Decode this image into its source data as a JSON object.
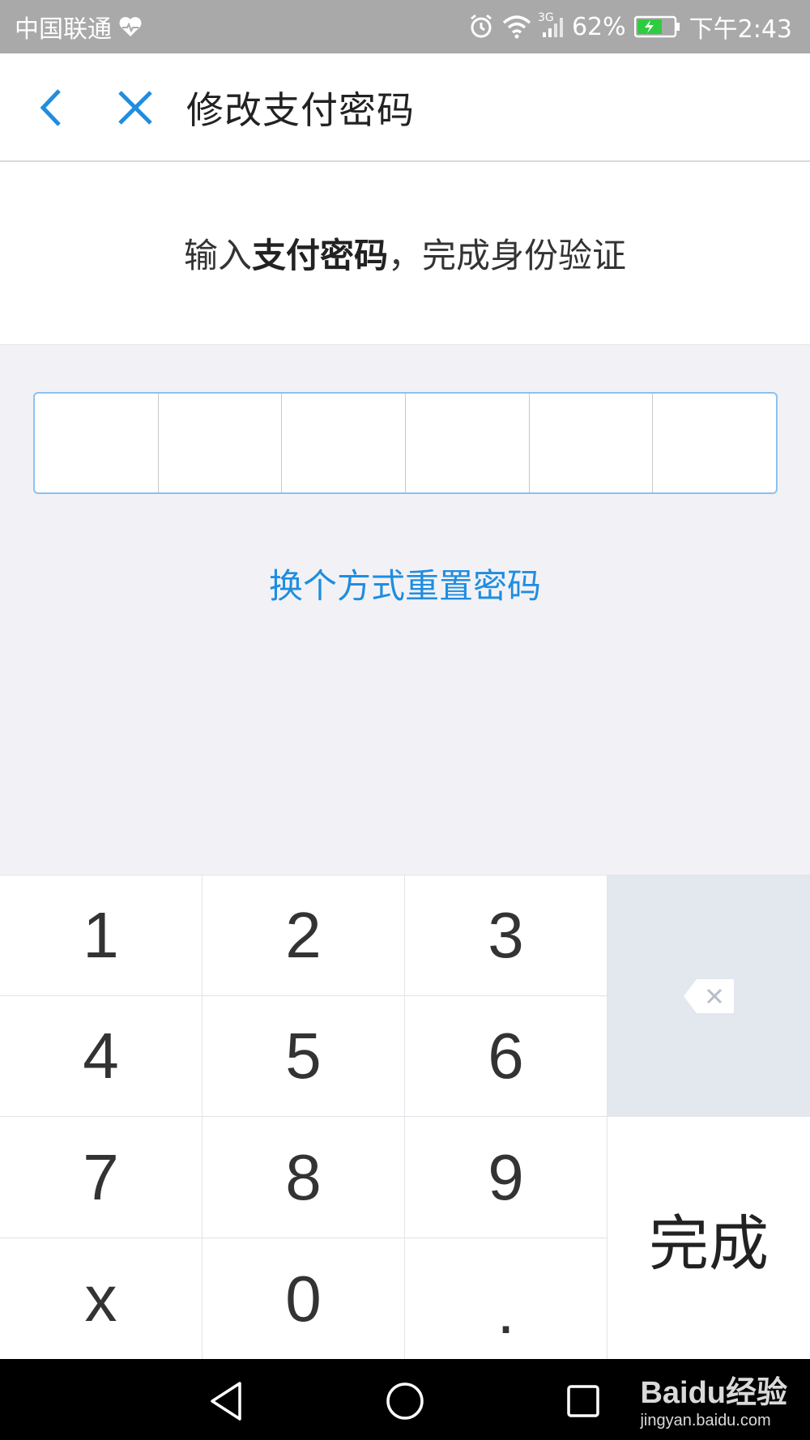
{
  "status_bar": {
    "carrier": "中国联通",
    "network": "3G",
    "battery": "62%",
    "time": "下午2:43",
    "icons": [
      "heartbeat-icon",
      "alarm-icon",
      "wifi-icon",
      "signal-icon",
      "battery-icon"
    ]
  },
  "header": {
    "title": "修改支付密码",
    "back_icon": "chevron-left-icon",
    "close_icon": "close-icon",
    "accent_color": "#1f8de0"
  },
  "instruction": {
    "prefix": "输入",
    "bold": "支付密码",
    "suffix": "，完成身份验证"
  },
  "pin": {
    "length": 6,
    "border_color": "#8cc1f1"
  },
  "reset_link": {
    "label": "换个方式重置密码"
  },
  "keypad": {
    "keys": [
      "1",
      "2",
      "3",
      "4",
      "5",
      "6",
      "7",
      "8",
      "9",
      "x",
      "0",
      "."
    ],
    "delete_icon": "backspace-icon",
    "done_label": "完成"
  },
  "nav_bar": {
    "icons": [
      "nav-back-icon",
      "nav-home-icon",
      "nav-recent-icon"
    ]
  },
  "watermark": {
    "brand": "Baidu经验",
    "url": "jingyan.baidu.com"
  }
}
